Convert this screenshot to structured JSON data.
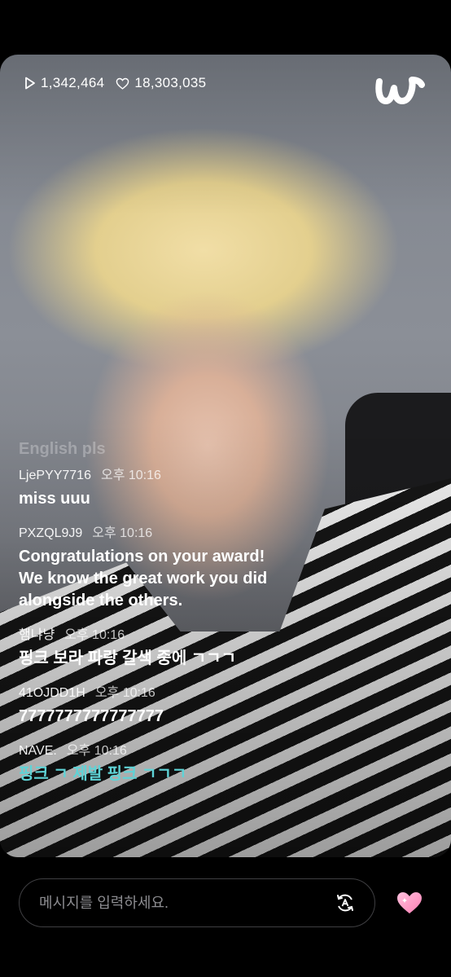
{
  "stats": {
    "plays": "1,342,464",
    "likes": "18,303,035"
  },
  "chat": {
    "faded_message": "English pls",
    "messages": [
      {
        "user": "LjePYY7716",
        "time": "오후 10:16",
        "text": "miss uuu",
        "color": "#ffffff"
      },
      {
        "user": "PXZQL9J9",
        "time": "오후 10:16",
        "text": "Congratulations on your award! We know the great work you did alongside the others.",
        "color": "#ffffff"
      },
      {
        "user": "햄냐냥",
        "time": "오후 10:16",
        "text": "핑크 보라 파랑 갈색 중에 ㄱㄱㄱ",
        "color": "#ffffff"
      },
      {
        "user": "41OJDD1H",
        "time": "오후 10:16",
        "text": "7777777777777777",
        "color": "#ffffff"
      },
      {
        "user": "NAVE.",
        "time": "오후 10:16",
        "text": "핑크 ㄱ 제발 핑크 ㄱㄱㄱ",
        "color": "#5fd3d6"
      }
    ]
  },
  "input": {
    "placeholder": "메시지를 입력하세요."
  },
  "icons": {
    "plays": "play-icon",
    "likes": "heart-outline-icon",
    "logo": "weverse-logo-icon",
    "translate": "translate-icon",
    "send_heart": "heart-filled-icon"
  },
  "colors": {
    "accent_teal": "#5fd3d6",
    "heart_pink": "#ff8fc0"
  }
}
